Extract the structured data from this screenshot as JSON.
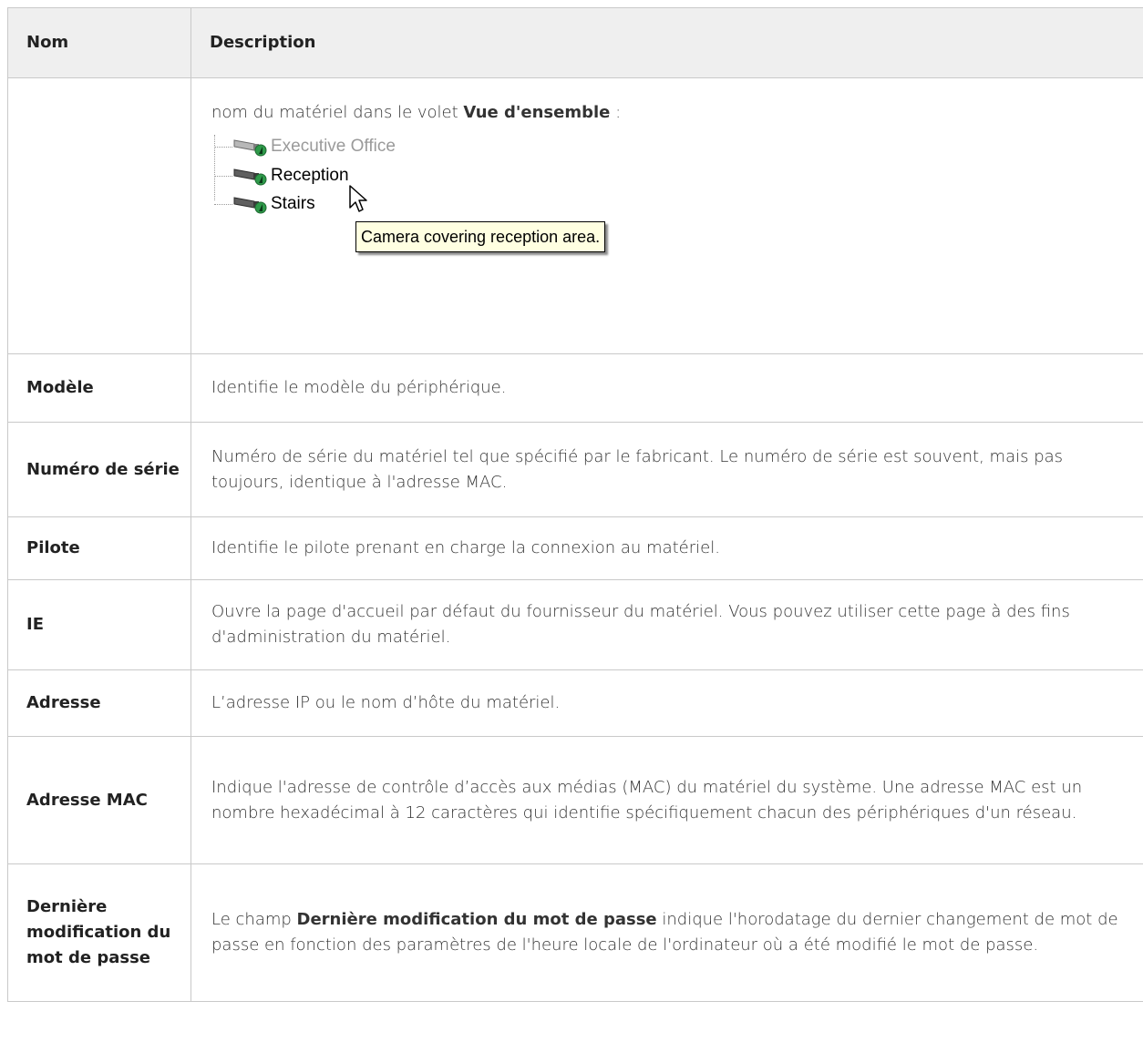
{
  "table": {
    "headers": {
      "name": "Nom",
      "description": "Description"
    },
    "first_row": {
      "text_before": "nom du matériel dans le volet ",
      "text_bold": "Vue d'ensemble",
      "text_after": " :",
      "screenshot": {
        "tree_items": [
          "Executive Office",
          "Reception",
          "Stairs"
        ],
        "tooltip": "Camera covering reception area."
      }
    },
    "rows": [
      {
        "name": "Modèle",
        "description": "Identifie le modèle du périphérique."
      },
      {
        "name": "Numéro de série",
        "description": "Numéro de série du matériel tel que spécifié par le fabricant. Le numéro de série est souvent, mais pas toujours, identique à l'adresse MAC."
      },
      {
        "name": "Pilote",
        "description": "Identifie le pilote prenant en charge la connexion au matériel."
      },
      {
        "name": "IE",
        "description": "Ouvre la page d'accueil par défaut du fournisseur du matériel. Vous pouvez utiliser cette page à des fins d'administration du matériel."
      },
      {
        "name": "Adresse",
        "description": "L’adresse IP ou le nom d’hôte du matériel."
      },
      {
        "name": "Adresse MAC",
        "description": "Indique l'adresse de contrôle d’accès aux médias (MAC) du matériel du système. Une adresse MAC est un nombre hexadécimal à 12 caractères qui identifie spécifiquement chacun des périphériques d'un réseau."
      }
    ],
    "last_row": {
      "name": "Dernière modification du mot de passe",
      "text_before": "Le champ ",
      "text_bold": "Dernière modification du mot de passe",
      "text_after": " indique l'horodatage du dernier changement de mot de passe en fonction des paramètres de l'heure locale de l'ordinateur où a été modifié le mot de passe."
    }
  }
}
